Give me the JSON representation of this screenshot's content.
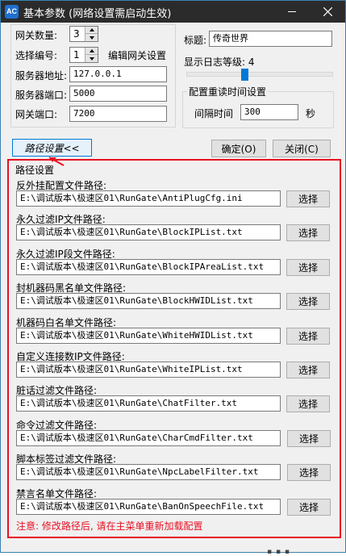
{
  "window": {
    "title": "基本参数 (网络设置需启动生效)",
    "app_icon_text": "AC"
  },
  "gateway": {
    "count_label": "网关数量:",
    "count_value": "3",
    "select_label": "选择编号:",
    "select_value": "1",
    "edit_label": "编辑网关设置",
    "server_addr_label": "服务器地址:",
    "server_addr_value": "127.0.0.1",
    "server_port_label": "服务器端口:",
    "server_port_value": "5000",
    "gate_port_label": "网关端口:",
    "gate_port_value": "7200"
  },
  "display": {
    "title_label": "标题:",
    "title_value": "传奇世界",
    "log_level_label": "显示日志等级: 4",
    "log_level": 4,
    "log_level_max": 10
  },
  "reload": {
    "group_title": "配置重读时间设置",
    "interval_label": "间隔时间",
    "interval_value": "300",
    "unit": "秒"
  },
  "buttons": {
    "path_settings": "路径设置<<",
    "ok": "确定(O)",
    "close": "关闭(C)",
    "choose": "选择"
  },
  "paths": {
    "group_title": "路径设置",
    "items": [
      {
        "label": "反外挂配置文件路径:",
        "value": "E:\\调试版本\\极速区01\\RunGate\\AntiPlugCfg.ini"
      },
      {
        "label": "永久过滤IP文件路径:",
        "value": "E:\\调试版本\\极速区01\\RunGate\\BlockIPList.txt"
      },
      {
        "label": "永久过滤IP段文件路径:",
        "value": "E:\\调试版本\\极速区01\\RunGate\\BlockIPAreaList.txt"
      },
      {
        "label": "封机器码黑名单文件路径:",
        "value": "E:\\调试版本\\极速区01\\RunGate\\BlockHWIDList.txt"
      },
      {
        "label": "机器码白名单文件路径:",
        "value": "E:\\调试版本\\极速区01\\RunGate\\WhiteHWIDList.txt"
      },
      {
        "label": "自定义连接数IP文件路径:",
        "value": "E:\\调试版本\\极速区01\\RunGate\\WhiteIPList.txt"
      },
      {
        "label": "脏话过滤文件路径:",
        "value": "E:\\调试版本\\极速区01\\RunGate\\ChatFilter.txt"
      },
      {
        "label": "命令过滤文件路径:",
        "value": "E:\\调试版本\\极速区01\\RunGate\\CharCmdFilter.txt"
      },
      {
        "label": "脚本标签过滤文件路径:",
        "value": "E:\\调试版本\\极速区01\\RunGate\\NpcLabelFilter.txt"
      },
      {
        "label": "禁言名单文件路径:",
        "value": "E:\\调试版本\\极速区01\\RunGate\\BanOnSpeechFile.txt"
      }
    ],
    "notice": "注意: 修改路径后, 请在主菜单重新加载配置"
  },
  "colors": {
    "highlight": "#e81123",
    "accent": "#0078d7",
    "titlebar": "#2b2b2b"
  }
}
